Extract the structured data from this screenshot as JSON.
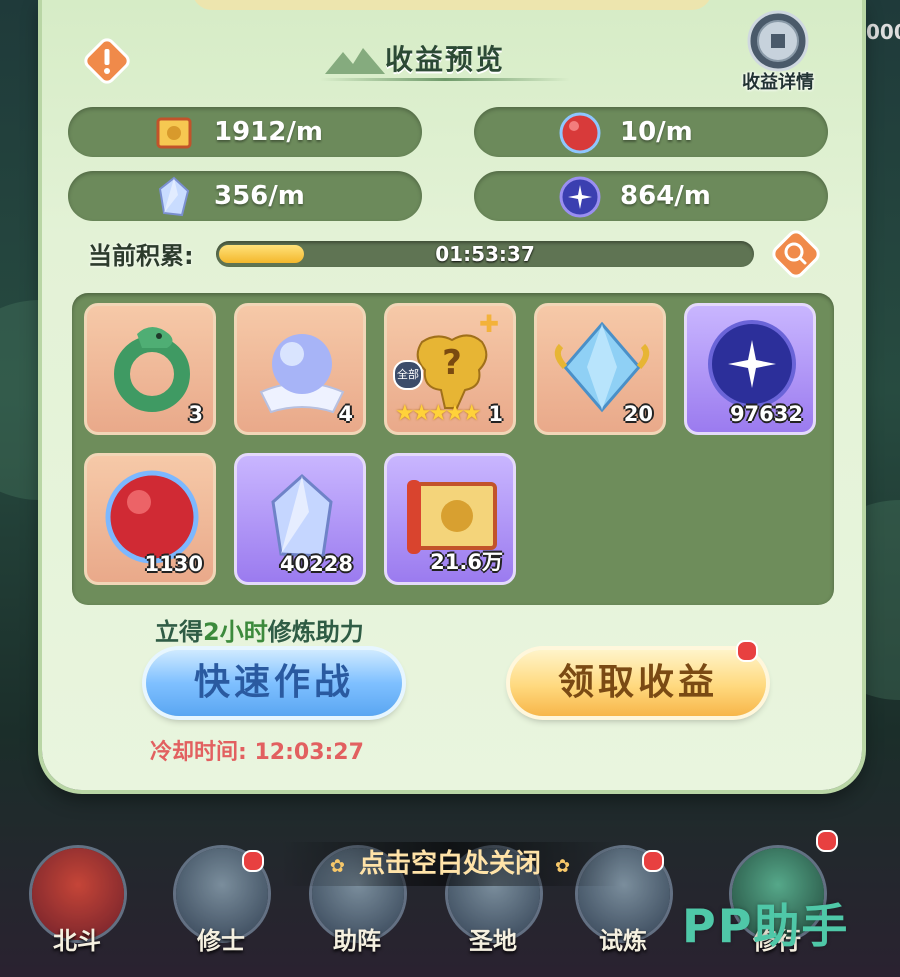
{
  "panel": {
    "title": "收益预览",
    "detail_label": "收益详情",
    "top_right_value": "000"
  },
  "rates": [
    {
      "icon": "gold-scroll-icon",
      "value": "1912/m"
    },
    {
      "icon": "red-orb-icon",
      "value": "10/m"
    },
    {
      "icon": "crystal-shard-icon",
      "value": "356/m"
    },
    {
      "icon": "star-orb-icon",
      "value": "864/m"
    }
  ],
  "accumulation": {
    "label": "当前积累:",
    "time": "01:53:37",
    "progress": 0.16
  },
  "items": [
    {
      "name": "jade-dragon-ring",
      "count": "3",
      "rarity": "orange"
    },
    {
      "name": "spirit-pearl",
      "count": "4",
      "rarity": "orange"
    },
    {
      "name": "golden-random-fragment",
      "count": "1",
      "rarity": "orange",
      "badge": "全部",
      "stars": 5
    },
    {
      "name": "blue-crystal-gem",
      "count": "20",
      "rarity": "orange"
    },
    {
      "name": "star-orb",
      "count": "97632",
      "rarity": "purple"
    },
    {
      "name": "red-orb",
      "count": "1130",
      "rarity": "orange"
    },
    {
      "name": "crystal-shard",
      "count": "40228",
      "rarity": "purple"
    },
    {
      "name": "gold-scroll",
      "count": "21.6万",
      "rarity": "purple"
    }
  ],
  "boost": {
    "prefix": "立得",
    "highlight": "2小时",
    "suffix": "修炼助力"
  },
  "buttons": {
    "fast_battle": "快速作战",
    "claim": "领取收益"
  },
  "cooldown": {
    "label": "冷却时间:",
    "time": "12:03:27"
  },
  "close_hint": "点击空白处关闭",
  "nav": [
    {
      "label": "北斗"
    },
    {
      "label": "修士"
    },
    {
      "label": "助阵"
    },
    {
      "label": "圣地"
    },
    {
      "label": "试炼"
    },
    {
      "label": "修行"
    }
  ],
  "watermark": "PP助手",
  "colors": {
    "panel_bg": "#e3f2d6",
    "pill_bg": "#6c8a5b",
    "fast_button": "#7fc0ff",
    "claim_button": "#ffd97e",
    "cooldown_text": "#e26060",
    "watermark": "#4fc8a8"
  }
}
